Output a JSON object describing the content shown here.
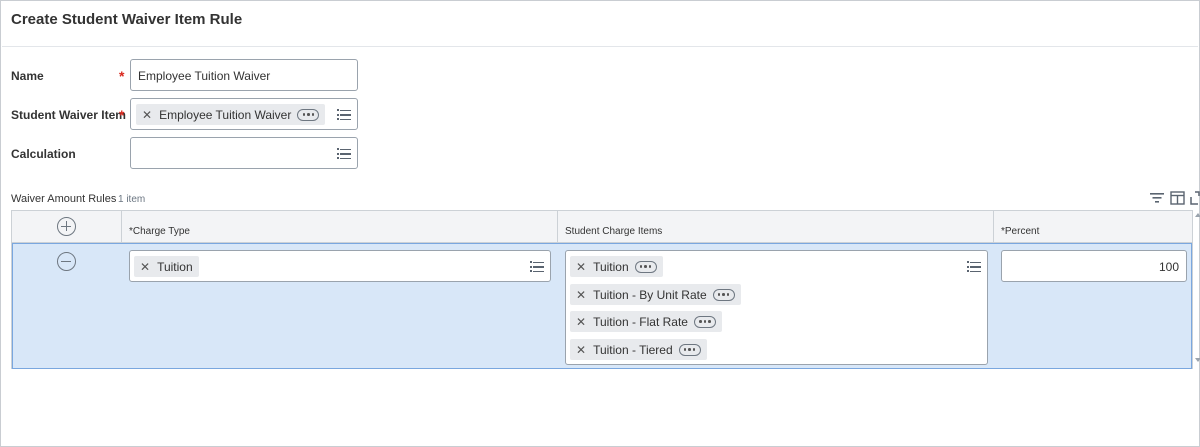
{
  "page": {
    "title": "Create Student Waiver Item Rule"
  },
  "form": {
    "name": {
      "label": "Name",
      "required_mark": "*",
      "value": "Employee Tuition Waiver"
    },
    "student_waiver_item": {
      "label": "Student Waiver Item",
      "required_mark": "*",
      "selected": "Employee Tuition Waiver"
    },
    "calculation": {
      "label": "Calculation",
      "value": ""
    }
  },
  "waiver_amount_rules": {
    "label": "Waiver Amount Rules",
    "count": "1 item",
    "columns": [
      "*Charge Type",
      "Student Charge Items",
      "*Percent"
    ],
    "rows": [
      {
        "charge_type": "Tuition",
        "student_charge_items": [
          "Tuition",
          "Tuition - By Unit Rate",
          "Tuition - Flat Rate",
          "Tuition - Tiered"
        ],
        "percent": "100"
      }
    ]
  },
  "icons": {
    "remove": "close-icon",
    "more": "more-options-icon",
    "prompt": "list-icon",
    "filter": "filter-icon",
    "columns": "column-layout-icon",
    "expand": "expand-icon",
    "add_row": "plus-circle-icon",
    "remove_row": "minus-circle-icon"
  },
  "colors": {
    "required": "#d9281e",
    "row_selected": "#d8e7f8",
    "row_border": "#7aa7df"
  }
}
